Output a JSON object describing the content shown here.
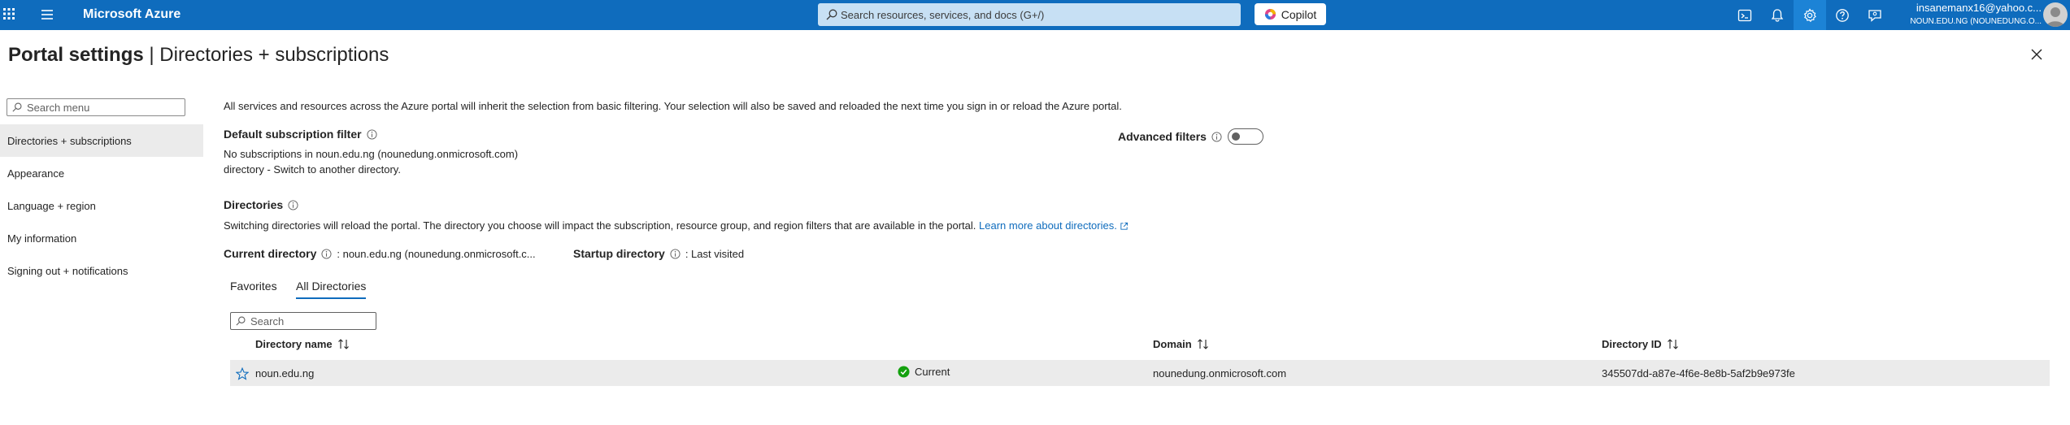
{
  "topbar": {
    "brand": "Microsoft Azure",
    "search_placeholder": "Search resources, services, and docs (G+/)",
    "copilot_label": "Copilot",
    "account_email": "insanemanx16@yahoo.c...",
    "account_tenant": "NOUN.EDU.NG (NOUNEDUNG.O..."
  },
  "page": {
    "title_main": "Portal settings",
    "title_separator": "|",
    "title_sub": "Directories + subscriptions"
  },
  "sidebar": {
    "search_placeholder": "Search menu",
    "items": [
      {
        "label": "Directories + subscriptions"
      },
      {
        "label": "Appearance"
      },
      {
        "label": "Language + region"
      },
      {
        "label": "My information"
      },
      {
        "label": "Signing out + notifications"
      }
    ]
  },
  "main": {
    "intro": "All services and resources across the Azure portal will inherit the selection from basic filtering. Your selection will also be saved and reloaded the next time you sign in or reload the Azure portal.",
    "default_filter_title": "Default subscription filter",
    "no_subs_line1": "No subscriptions in noun.edu.ng (nounedung.onmicrosoft.com)",
    "no_subs_line2": "directory - Switch to another directory.",
    "advanced_filters_label": "Advanced filters",
    "directories_title": "Directories",
    "directories_desc": "Switching directories will reload the portal. The directory you choose will impact the subscription, resource group, and region filters that are available in the portal.",
    "learn_more": "Learn more about directories.",
    "current_directory_label": "Current directory",
    "current_directory_value": ": noun.edu.ng (nounedung.onmicrosoft.c...",
    "startup_directory_label": "Startup directory",
    "startup_directory_value": ": Last visited",
    "tabs": [
      {
        "label": "Favorites"
      },
      {
        "label": "All Directories"
      }
    ],
    "dir_search_placeholder": "Search",
    "columns": {
      "name": "Directory name",
      "domain": "Domain",
      "id": "Directory ID"
    },
    "rows": [
      {
        "name": "noun.edu.ng",
        "status": "Current",
        "domain": "nounedung.onmicrosoft.com",
        "id": "345507dd-a87e-4f6e-8e8b-5af2b9e973fe"
      }
    ]
  },
  "colors": {
    "accent": "#0f6cbd",
    "success": "#13a10e"
  }
}
